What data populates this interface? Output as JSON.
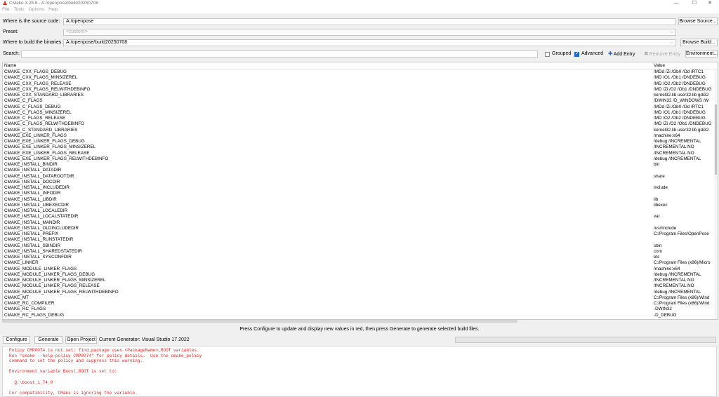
{
  "window": {
    "title": "CMake 3.28.6 - A:/openpose/build20250708"
  },
  "menu": [
    "File",
    "Tools",
    "Options",
    "Help"
  ],
  "source": {
    "label": "Where is the source code:",
    "value": "A:/openpose",
    "button": "Browse Source..."
  },
  "preset": {
    "label": "Preset:",
    "value": "<custom>"
  },
  "binaries": {
    "label": "Where to build the binaries:",
    "value": "A:/openpose/build20250708",
    "button": "Browse Build..."
  },
  "search": {
    "label": "Search:",
    "value": ""
  },
  "options": {
    "grouped": "Grouped",
    "grouped_checked": false,
    "advanced": "Advanced",
    "advanced_checked": true,
    "add_entry": "Add Entry",
    "remove_entry": "Remove Entry",
    "environment": "Environment..."
  },
  "table": {
    "headers": {
      "name": "Name",
      "value": "Value"
    },
    "rows": [
      {
        "name": "CMAKE_CXX_FLAGS_DEBUG",
        "value": "/MDd /Zi /Ob0 /Od /RTC1"
      },
      {
        "name": "CMAKE_CXX_FLAGS_MINSIZEREL",
        "value": "/MD /O1 /Ob1 /DNDEBUG"
      },
      {
        "name": "CMAKE_CXX_FLAGS_RELEASE",
        "value": "/MD /O2 /Ob2 /DNDEBUG"
      },
      {
        "name": "CMAKE_CXX_FLAGS_RELWITHDEBINFO",
        "value": "/MD /Zi /O2 /Ob1 /DNDEBUG"
      },
      {
        "name": "CMAKE_CXX_STANDARD_LIBRARIES",
        "value": "kernel32.lib user32.lib gdi32"
      },
      {
        "name": "CMAKE_C_FLAGS",
        "value": "/DWIN32 /D_WINDOWS /W"
      },
      {
        "name": "CMAKE_C_FLAGS_DEBUG",
        "value": "/MDd /Zi /Ob0 /Od /RTC1"
      },
      {
        "name": "CMAKE_C_FLAGS_MINSIZEREL",
        "value": "/MD /O1 /Ob1 /DNDEBUG"
      },
      {
        "name": "CMAKE_C_FLAGS_RELEASE",
        "value": "/MD /O2 /Ob2 /DNDEBUG"
      },
      {
        "name": "CMAKE_C_FLAGS_RELWITHDEBINFO",
        "value": "/MD /Zi /O2 /Ob1 /DNDEBUG"
      },
      {
        "name": "CMAKE_C_STANDARD_LIBRARIES",
        "value": "kernel32.lib user32.lib gdi32"
      },
      {
        "name": "CMAKE_EXE_LINKER_FLAGS",
        "value": "/machine:x64"
      },
      {
        "name": "CMAKE_EXE_LINKER_FLAGS_DEBUG",
        "value": "/debug /INCREMENTAL"
      },
      {
        "name": "CMAKE_EXE_LINKER_FLAGS_MINSIZEREL",
        "value": "/INCREMENTAL:NO"
      },
      {
        "name": "CMAKE_EXE_LINKER_FLAGS_RELEASE",
        "value": "/INCREMENTAL:NO"
      },
      {
        "name": "CMAKE_EXE_LINKER_FLAGS_RELWITHDEBINFO",
        "value": "/debug /INCREMENTAL"
      },
      {
        "name": "CMAKE_INSTALL_BINDIR",
        "value": "bin"
      },
      {
        "name": "CMAKE_INSTALL_DATADIR",
        "value": ""
      },
      {
        "name": "CMAKE_INSTALL_DATAROOTDIR",
        "value": "share"
      },
      {
        "name": "CMAKE_INSTALL_DOCDIR",
        "value": ""
      },
      {
        "name": "CMAKE_INSTALL_INCLUDEDIR",
        "value": "include"
      },
      {
        "name": "CMAKE_INSTALL_INFODIR",
        "value": ""
      },
      {
        "name": "CMAKE_INSTALL_LIBDIR",
        "value": "lib"
      },
      {
        "name": "CMAKE_INSTALL_LIBEXECDIR",
        "value": "libexec"
      },
      {
        "name": "CMAKE_INSTALL_LOCALEDIR",
        "value": ""
      },
      {
        "name": "CMAKE_INSTALL_LOCALSTATEDIR",
        "value": "var"
      },
      {
        "name": "CMAKE_INSTALL_MANDIR",
        "value": ""
      },
      {
        "name": "CMAKE_INSTALL_OLDINCLUDEDIR",
        "value": "/usr/include"
      },
      {
        "name": "CMAKE_INSTALL_PREFIX",
        "value": "C:/Program Files/OpenPose"
      },
      {
        "name": "CMAKE_INSTALL_RUNSTATEDIR",
        "value": ""
      },
      {
        "name": "CMAKE_INSTALL_SBINDIR",
        "value": "sbin"
      },
      {
        "name": "CMAKE_INSTALL_SHAREDSTATEDIR",
        "value": "com"
      },
      {
        "name": "CMAKE_INSTALL_SYSCONFDIR",
        "value": "etc"
      },
      {
        "name": "CMAKE_LINKER",
        "value": "C:/Program Files (x86)/Micro"
      },
      {
        "name": "CMAKE_MODULE_LINKER_FLAGS",
        "value": "/machine:x64"
      },
      {
        "name": "CMAKE_MODULE_LINKER_FLAGS_DEBUG",
        "value": "/debug /INCREMENTAL"
      },
      {
        "name": "CMAKE_MODULE_LINKER_FLAGS_MINSIZEREL",
        "value": "/INCREMENTAL:NO"
      },
      {
        "name": "CMAKE_MODULE_LINKER_FLAGS_RELEASE",
        "value": "/INCREMENTAL:NO"
      },
      {
        "name": "CMAKE_MODULE_LINKER_FLAGS_RELWITHDEBINFO",
        "value": "/debug /INCREMENTAL"
      },
      {
        "name": "CMAKE_MT",
        "value": "C:/Program Files (x86)/Wind"
      },
      {
        "name": "CMAKE_RC_COMPILER",
        "value": "C:/Program Files (x86)/Wind"
      },
      {
        "name": "CMAKE_RC_FLAGS",
        "value": "-DWIN32"
      },
      {
        "name": "CMAKE_RC_FLAGS_DEBUG",
        "value": "-D_DEBUG"
      }
    ]
  },
  "status_message": "Press Configure to update and display new values in red, then press Generate to generate selected build files.",
  "actions": {
    "configure": "Configure",
    "generate": "Generate",
    "open_project": "Open Project",
    "current_generator": "Current Generator: Visual Studio 17 2022"
  },
  "output_text": "Policy CMP0074 is not set: find_package uses <PackageName>_ROOT variables.\nRun \"cmake --help-policy CMP0074\" for policy details.  Use the cmake_policy\ncommand to set the policy and suppress this warning.\n\nEnvironment variable Boost_ROOT is set to:\n\n  Q:\\boost_1_74_0\n\nFor compatibility, CMake is ignoring the variable.",
  "colors": {
    "output_text": "#e02020",
    "accent": "#2167c7"
  }
}
